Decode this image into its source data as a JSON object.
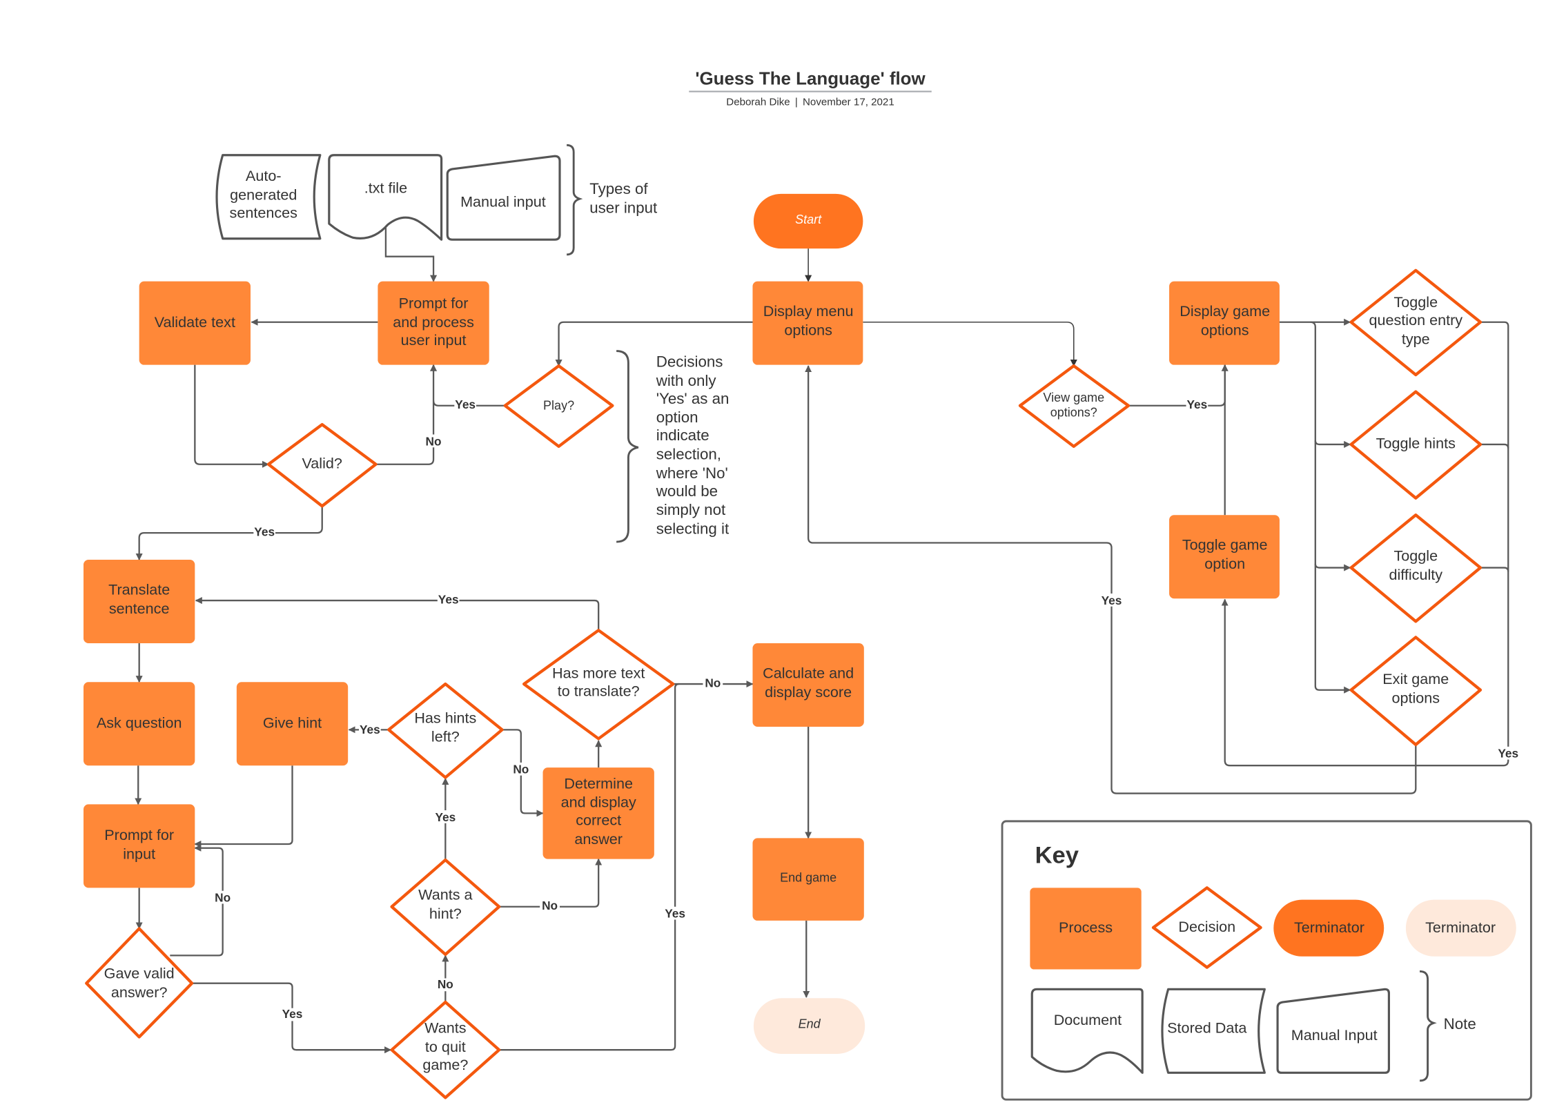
{
  "header": {
    "title": "'Guess The Language' flow",
    "author": "Deborah Dike",
    "separator": "|",
    "date": "November 17, 2021"
  },
  "colors": {
    "process_fill": "#FF8838",
    "decision_stroke": "#F4580E",
    "terminator_start_fill": "#FF7420",
    "terminator_end_fill": "#FEE9DB",
    "connector": "#595959",
    "text": "#333333"
  },
  "inputs": {
    "stored_data": [
      "Auto-",
      "generated",
      "sentences"
    ],
    "document": ".txt file",
    "manual_input": "Manual input",
    "note": [
      "Types of",
      "user input"
    ]
  },
  "nodes": {
    "start": "Start",
    "display_menu": [
      "Display menu",
      "options"
    ],
    "prompt_process": [
      "Prompt for",
      "and process",
      "user input"
    ],
    "validate_text": "Validate text",
    "valid": "Valid?",
    "play": "Play?",
    "view_game_options": [
      "View game",
      "options?"
    ],
    "display_game_options": [
      "Display game",
      "options"
    ],
    "toggle_question_entry": [
      "Toggle",
      "question entry",
      "type"
    ],
    "toggle_hints": "Toggle hints",
    "toggle_difficulty": [
      "Toggle",
      "difficulty"
    ],
    "exit_game_options": [
      "Exit game",
      "options"
    ],
    "toggle_game_option": [
      "Toggle game",
      "option"
    ],
    "translate_sentence": [
      "Translate",
      "sentence"
    ],
    "ask_question": "Ask question",
    "give_hint": "Give hint",
    "has_hints_left": [
      "Has hints",
      "left?"
    ],
    "has_more_text": [
      "Has more text",
      "to translate?"
    ],
    "determine_answer": [
      "Determine",
      "and display",
      "correct",
      "answer"
    ],
    "prompt_input": [
      "Prompt for",
      "input"
    ],
    "gave_valid_answer": [
      "Gave valid",
      "answer?"
    ],
    "wants_hint": [
      "Wants a",
      "hint?"
    ],
    "wants_quit": [
      "Wants",
      "to quit",
      "game?"
    ],
    "calculate_score": [
      "Calculate and",
      "display score"
    ],
    "end_game": "End game",
    "end": "End"
  },
  "decision_note": [
    "Decisions",
    "with only",
    "'Yes' as an",
    "option",
    "indicate",
    "selection,",
    "where 'No'",
    "would be",
    "simply not",
    "selecting it"
  ],
  "edge_labels": {
    "yes": "Yes",
    "no": "No"
  },
  "key": {
    "title": "Key",
    "process": "Process",
    "decision": "Decision",
    "terminator_dark": "Terminator",
    "terminator_light": "Terminator",
    "document": "Document",
    "stored_data": "Stored Data",
    "manual_input": "Manual Input",
    "note": "Note"
  }
}
